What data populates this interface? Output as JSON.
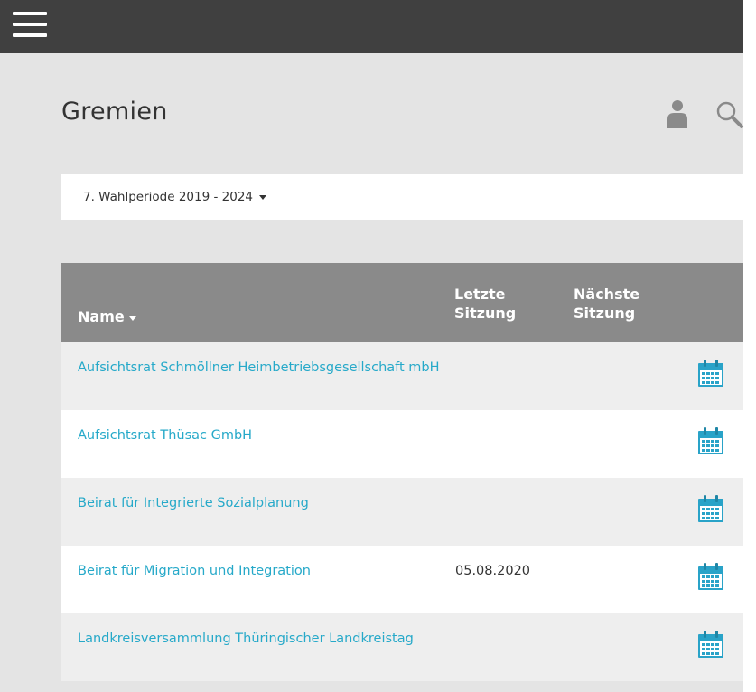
{
  "header": {
    "menu_icon": "hamburger-menu-icon"
  },
  "page": {
    "title": "Gremien",
    "user_icon": "user-icon",
    "search_icon": "search-icon"
  },
  "period_select": {
    "value": "7. Wahlperiode 2019 - 2024"
  },
  "table": {
    "columns": {
      "name": "Name",
      "last_meeting": "Letzte Sitzung",
      "next_meeting": "Nächste Sitzung"
    },
    "rows": [
      {
        "name": "Aufsichtsrat Schmöllner Heimbetriebsgesellschaft mbH",
        "last": "",
        "next": ""
      },
      {
        "name": "Aufsichtsrat Thüsac GmbH",
        "last": "",
        "next": ""
      },
      {
        "name": "Beirat für Integrierte Sozialplanung",
        "last": "",
        "next": ""
      },
      {
        "name": "Beirat für Migration und Integration",
        "last": "05.08.2020",
        "next": ""
      },
      {
        "name": "Landkreisversammlung Thüringischer Landkreistag",
        "last": "",
        "next": ""
      }
    ],
    "row_icon": "calendar-icon"
  },
  "colors": {
    "topbar": "#404040",
    "background": "#e4e4e4",
    "table_header": "#8a8a8a",
    "link": "#26a9c9",
    "calendar_icon": "#29a3c8"
  }
}
